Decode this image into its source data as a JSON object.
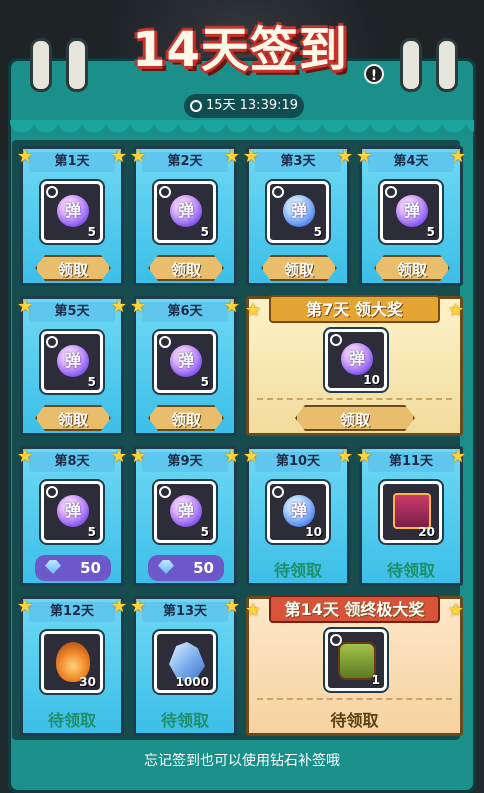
{
  "header": {
    "title": "14天签到",
    "timer": "15天 13:39:19",
    "help_symbol": "!"
  },
  "days": [
    {
      "label": "第1天",
      "icon": "bullet-orb",
      "glyph": "弹",
      "qty": "5",
      "action": "领取"
    },
    {
      "label": "第2天",
      "icon": "bullet-orb",
      "glyph": "弹",
      "qty": "5",
      "action": "领取"
    },
    {
      "label": "第3天",
      "icon": "bullet-orb",
      "glyph": "弹",
      "qty": "5",
      "action": "领取"
    },
    {
      "label": "第4天",
      "icon": "bullet-orb",
      "glyph": "弹",
      "qty": "5",
      "action": "领取"
    },
    {
      "label": "第5天",
      "icon": "bullet-orb",
      "glyph": "弹",
      "qty": "5",
      "action": "领取"
    },
    {
      "label": "第6天",
      "icon": "bullet-orb",
      "glyph": "弹",
      "qty": "5",
      "action": "领取"
    },
    {
      "label": "第7天 领大奖",
      "icon": "bullet-orb",
      "glyph": "弹",
      "qty": "10",
      "action": "领取"
    },
    {
      "label": "第8天",
      "icon": "bullet-orb",
      "glyph": "弹",
      "qty": "5",
      "action": "50"
    },
    {
      "label": "第9天",
      "icon": "bullet-orb",
      "glyph": "弹",
      "qty": "5",
      "action": "50"
    },
    {
      "label": "第10天",
      "icon": "bullet-orb",
      "glyph": "弹",
      "qty": "10",
      "action": "待领取"
    },
    {
      "label": "第11天",
      "icon": "treasure-chest",
      "qty": "20",
      "action": "待领取"
    },
    {
      "label": "第12天",
      "icon": "fire-spirit",
      "qty": "30",
      "action": "待领取"
    },
    {
      "label": "第13天",
      "icon": "crystal",
      "qty": "1000",
      "action": "待领取"
    },
    {
      "label": "第14天 领终极大奖",
      "icon": "gift-basket",
      "qty": "1",
      "action": "待领取"
    }
  ],
  "footer": "忘记签到也可以使用钻石补签哦",
  "colors": {
    "panel": "#1b8f8a",
    "card_blue": "#4fc8ee",
    "claim_button": "#e8bd6c",
    "diamond_button": "#6d58c9",
    "pending_text": "#1e8f6a",
    "title_red": "#c4332b"
  }
}
